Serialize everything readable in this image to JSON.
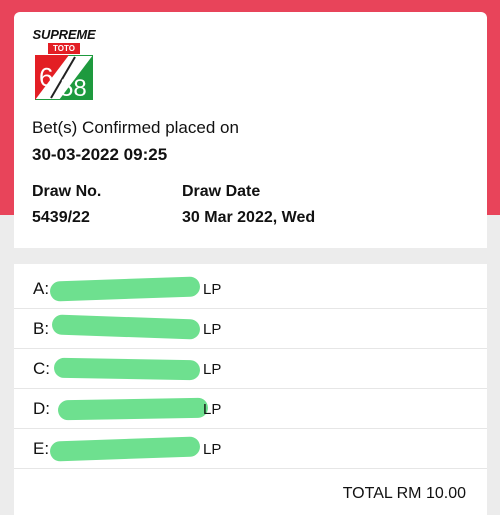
{
  "logo": {
    "brand": "SUPREME",
    "sub": "TOTO",
    "game_left": "6",
    "game_right": "58"
  },
  "confirmation": {
    "message": "Bet(s) Confirmed placed on",
    "datetime": "30-03-2022 09:25"
  },
  "draw": {
    "number_label": "Draw No.",
    "number": "5439/22",
    "date_label": "Draw Date",
    "date": "30 Mar 2022, Wed"
  },
  "bets": [
    {
      "label": "A:",
      "suffix": "LP"
    },
    {
      "label": "B:",
      "suffix": "LP"
    },
    {
      "label": "C:",
      "suffix": "LP"
    },
    {
      "label": "D:",
      "suffix": "LP"
    },
    {
      "label": "E:",
      "suffix": "LP"
    }
  ],
  "total": "TOTAL RM 10.00",
  "colors": {
    "header_band": "#e8445a",
    "redaction": "#6ee08f",
    "logo_red": "#e31e24",
    "logo_green": "#1e9a3e"
  }
}
